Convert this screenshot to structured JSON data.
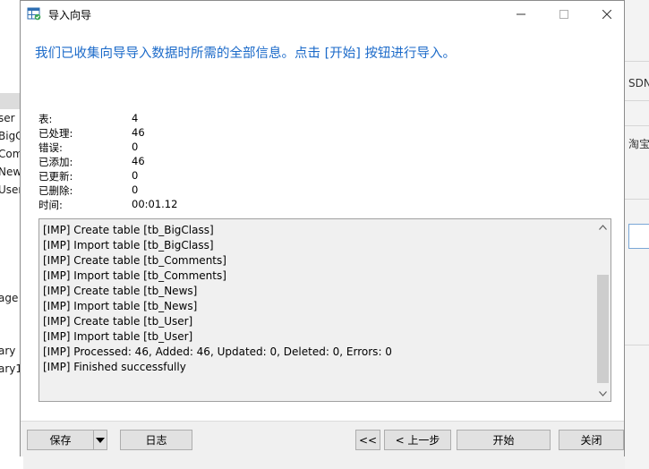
{
  "window": {
    "title": "导入向导"
  },
  "header": {
    "message": "我们已收集向导导入数据时所需的全部信息。点击 [开始] 按钮进行导入。"
  },
  "stats": [
    {
      "label": "表:",
      "value": "4"
    },
    {
      "label": "已处理:",
      "value": "46"
    },
    {
      "label": "错误:",
      "value": "0"
    },
    {
      "label": "已添加:",
      "value": "46"
    },
    {
      "label": "已更新:",
      "value": "0"
    },
    {
      "label": "已删除:",
      "value": "0"
    },
    {
      "label": "时间:",
      "value": "00:01.12"
    }
  ],
  "log": [
    "[IMP] Create table [tb_BigClass]",
    "[IMP] Import table [tb_BigClass]",
    "[IMP] Create table [tb_Comments]",
    "[IMP] Import table [tb_Comments]",
    "[IMP] Create table [tb_News]",
    "[IMP] Import table [tb_News]",
    "[IMP] Create table [tb_User]",
    "[IMP] Import table [tb_User]",
    "[IMP] Processed: 46, Added: 46, Updated: 0, Deleted: 0, Errors: 0",
    "[IMP] Finished successfully"
  ],
  "footer": {
    "save_label": "保存",
    "log_label": "日志",
    "first_label": "<<",
    "prev_label": "< 上一步",
    "start_label": "开始",
    "close_label": "关闭"
  },
  "background": {
    "left_items": [
      "ser",
      "BigC",
      "Com",
      "New",
      "User",
      "age",
      "ary",
      "ary1"
    ],
    "right_items": [
      "SDN",
      "淘宝"
    ]
  },
  "colors": {
    "accent_text": "#1b6ac9",
    "log_background": "#f0f0f0",
    "button_face": "#e1e1e1"
  }
}
